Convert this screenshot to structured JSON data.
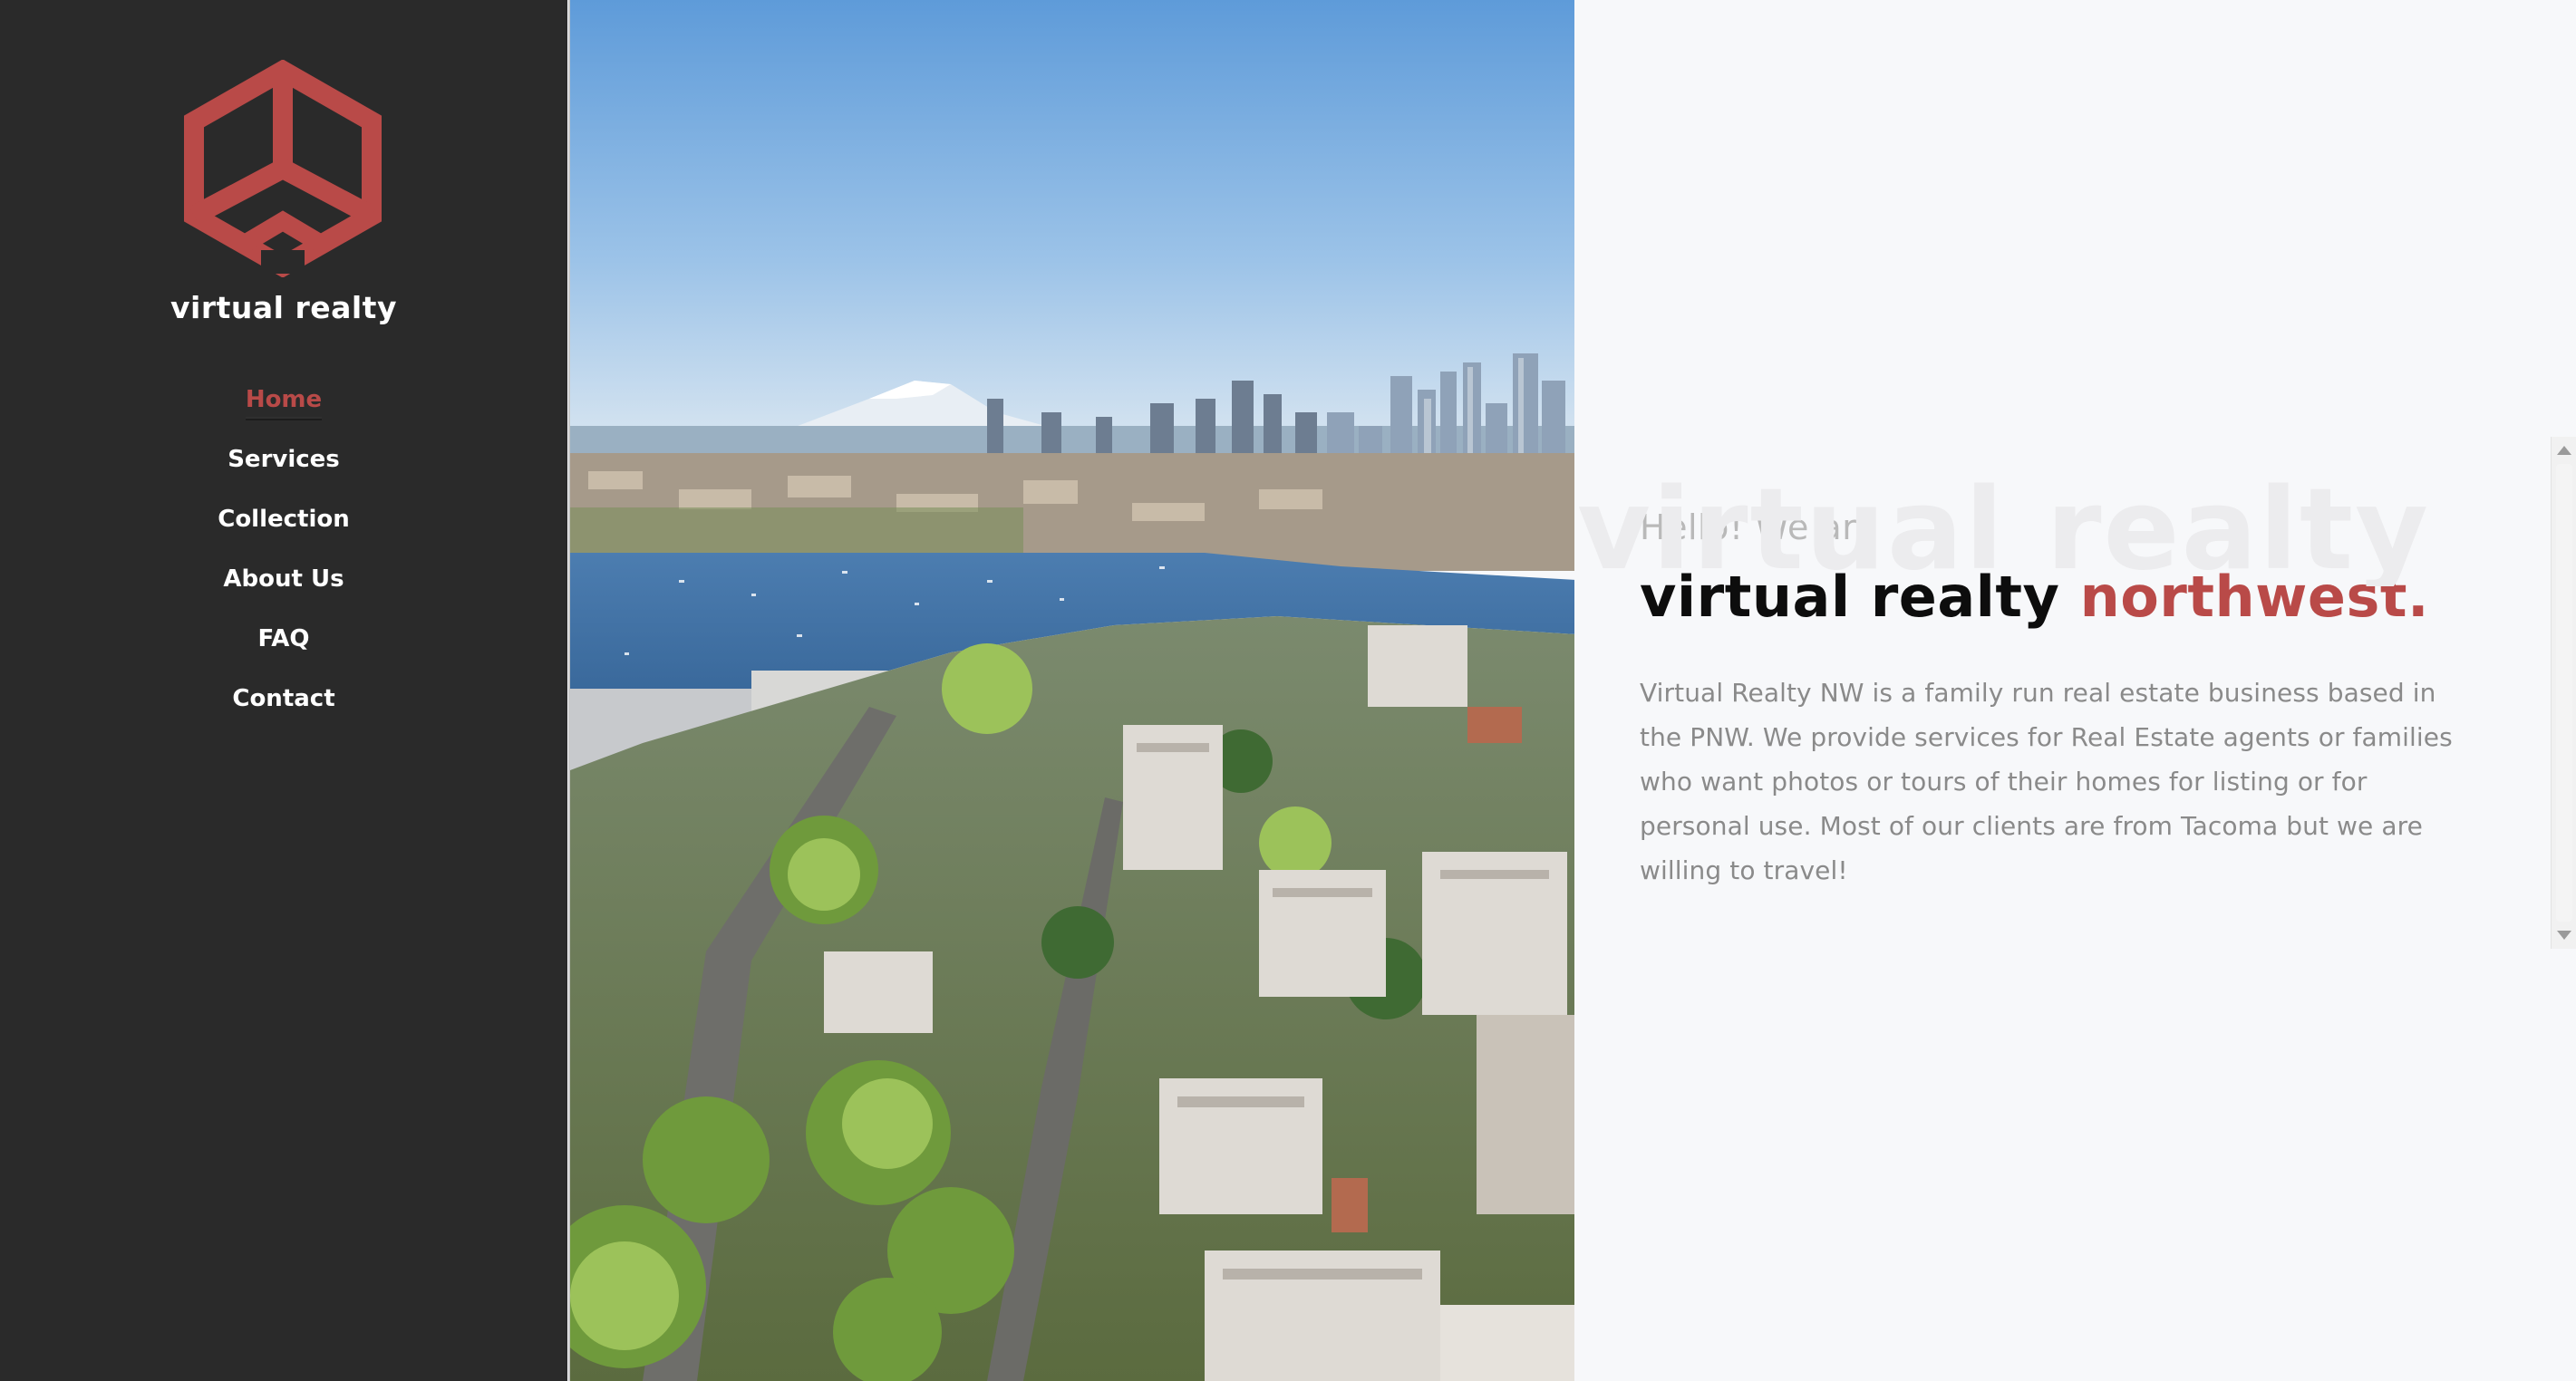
{
  "brand": {
    "name": "virtual realty",
    "logo_icon": "hexagon-cube-icon",
    "accent_color": "#b94a48"
  },
  "sidebar": {
    "background": "#2a2a2a",
    "items": [
      {
        "label": "Home",
        "active": true
      },
      {
        "label": "Services",
        "active": false
      },
      {
        "label": "Collection",
        "active": false
      },
      {
        "label": "About Us",
        "active": false
      },
      {
        "label": "FAQ",
        "active": false
      },
      {
        "label": "Contact",
        "active": false
      }
    ]
  },
  "hero": {
    "image_subject": "aerial-city-skyline-with-lake-and-mountain",
    "watermark": "virtual realty",
    "greeting": "Hello! We are",
    "headline_main": "virtual realty",
    "headline_accent": "northwest.",
    "description": "Virtual Realty NW is a family run real estate business based in the PNW. We provide services for Real Estate agents or families who want photos or tours of their homes for listing or for personal use. Most of our clients are from Tacoma but we are willing to travel!"
  }
}
